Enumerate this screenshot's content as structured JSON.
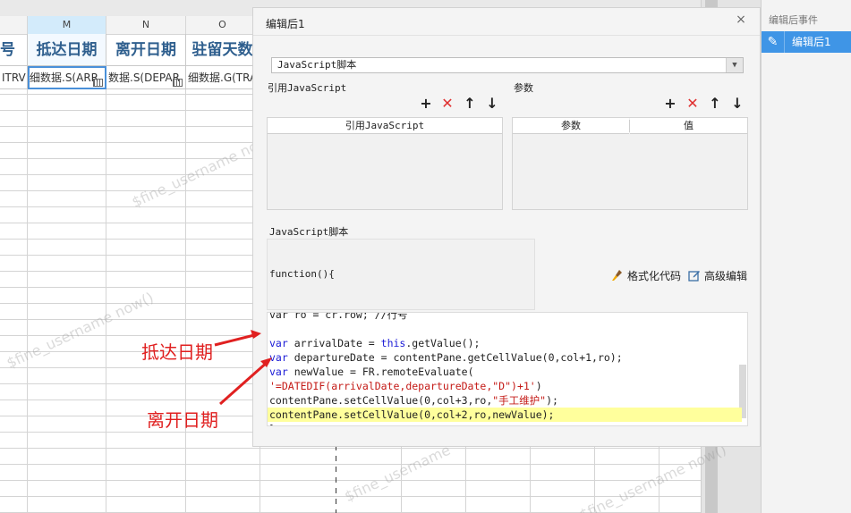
{
  "sheet": {
    "columns": [
      {
        "letter": "M",
        "active": true
      },
      {
        "letter": "N",
        "active": false
      },
      {
        "letter": "O",
        "active": false
      }
    ],
    "headers": [
      "号",
      "抵达日期",
      "离开日期",
      "驻留天数"
    ],
    "row": [
      "ITRV",
      "细数据.S(ARR",
      "数据.S(DEPAR",
      "细数据.G(TRA"
    ]
  },
  "dialog": {
    "title": "编辑后1",
    "close": "×",
    "script_type": "JavaScript脚本",
    "ref_js_label": "引用JavaScript",
    "params_label": "参数",
    "ref_js_column": "引用JavaScript",
    "param_col_name": "参数",
    "param_col_value": "值",
    "toolbar": {
      "add": "+",
      "delete": "✕",
      "up": "↑",
      "down": "↓"
    },
    "script_label": "JavaScript脚本",
    "function_header": "function(){",
    "format_code": "格式化代码",
    "advanced_edit": "高级编辑",
    "code_lines": [
      {
        "parts": [
          {
            "t": "var ro = cr.row; //行号",
            "c": ""
          }
        ],
        "highlight": false
      },
      {
        "parts": [
          {
            "t": "",
            "c": ""
          }
        ],
        "highlight": false
      },
      {
        "parts": [
          {
            "t": "var",
            "c": "kw"
          },
          {
            "t": " arrivalDate = ",
            "c": ""
          },
          {
            "t": "this",
            "c": "kw"
          },
          {
            "t": ".getValue();",
            "c": ""
          }
        ],
        "highlight": false
      },
      {
        "parts": [
          {
            "t": "var",
            "c": "kw"
          },
          {
            "t": " departureDate = contentPane.getCellValue(0,col+1,ro);",
            "c": ""
          }
        ],
        "highlight": false
      },
      {
        "parts": [
          {
            "t": "var",
            "c": "kw"
          },
          {
            "t": " newValue = FR.remoteEvaluate(",
            "c": ""
          }
        ],
        "highlight": false
      },
      {
        "parts": [
          {
            "t": "'=DATEDIF(arrivalDate,departureDate,\"D\")+1'",
            "c": "str"
          },
          {
            "t": ")",
            "c": ""
          }
        ],
        "highlight": false
      },
      {
        "parts": [
          {
            "t": "contentPane.setCellValue(0,col+3,ro,",
            "c": ""
          },
          {
            "t": "\"手工维护\"",
            "c": "str"
          },
          {
            "t": ");",
            "c": ""
          }
        ],
        "highlight": false
      },
      {
        "parts": [
          {
            "t": "contentPane.setCellValue(0,col+2,ro,newValue);",
            "c": ""
          }
        ],
        "highlight": true
      },
      {
        "parts": [
          {
            "t": "}",
            "c": ""
          }
        ],
        "highlight": false
      }
    ]
  },
  "right_panel": {
    "title": "编辑后事件",
    "item_label": "编辑后1",
    "item_icon": "pencil-icon"
  },
  "annotations": {
    "arrival": "抵达日期",
    "departure": "离开日期"
  },
  "watermarks": [
    "$fine_username now()",
    "$fine_username now()",
    "$fine_username",
    "$fine_username now()"
  ],
  "colors": {
    "accent": "#3f95e6",
    "annotation": "#e02020",
    "header_text": "#2f5f8e",
    "highlight_line": "#ffff9c"
  }
}
